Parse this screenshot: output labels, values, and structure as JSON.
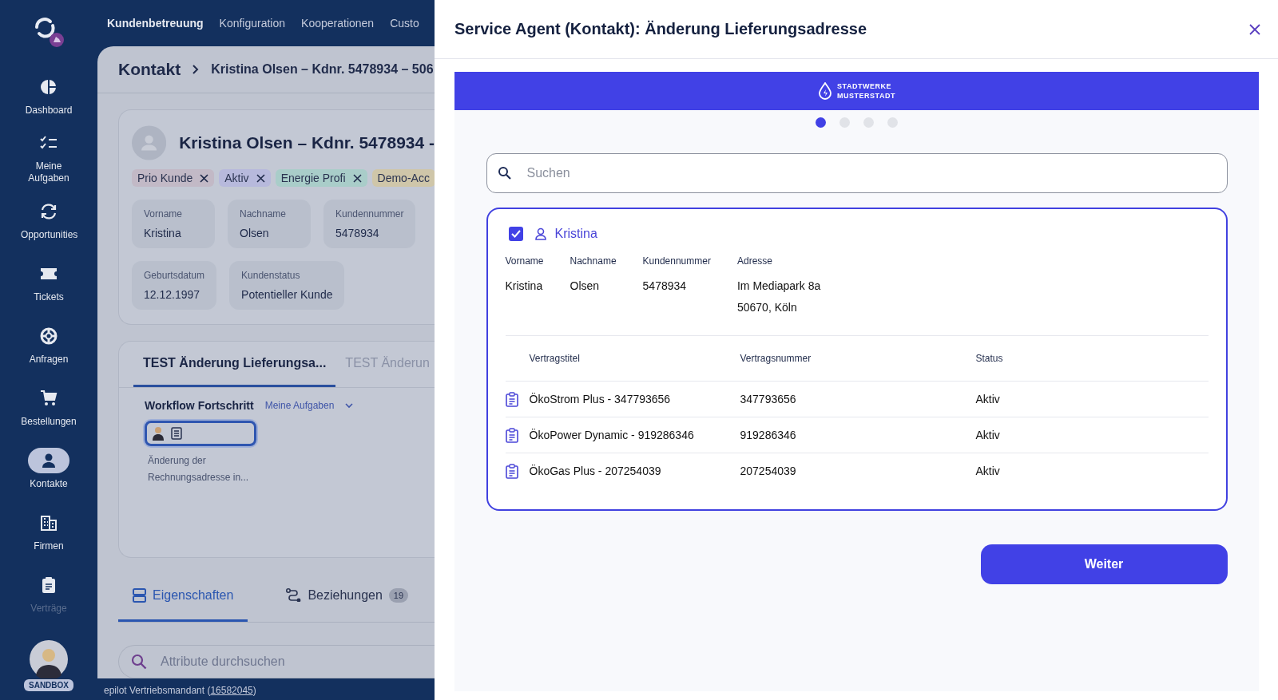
{
  "sidebar": {
    "items": [
      {
        "label": "Dashboard",
        "selected": false
      },
      {
        "label": "Meine Aufgaben",
        "selected": false
      },
      {
        "label": "Opportunities",
        "selected": false
      },
      {
        "label": "Tickets",
        "selected": false
      },
      {
        "label": "Anfragen",
        "selected": false
      },
      {
        "label": "Bestellungen",
        "selected": false
      },
      {
        "label": "Kontakte",
        "selected": true
      },
      {
        "label": "Firmen",
        "selected": false
      },
      {
        "label": "Verträge",
        "selected": false
      }
    ],
    "user_badge": "SANDBOX"
  },
  "top_nav": [
    {
      "label": "Kundenbetreuung",
      "selected": true
    },
    {
      "label": "Konfiguration",
      "selected": false
    },
    {
      "label": "Kooperationen",
      "selected": false
    },
    {
      "label": "Custo",
      "selected": false
    }
  ],
  "breadcrumb": {
    "root": "Kontakt",
    "current": "Kristina Olsen – Kdnr. 5478934 – 506"
  },
  "contact_card": {
    "title": "Kristina Olsen – Kdnr. 5478934 -",
    "tags": [
      {
        "label": "Prio Kunde",
        "color": "#c2b9c6",
        "removable": true
      },
      {
        "label": "Aktiv",
        "color": "#b7b9dc",
        "removable": true
      },
      {
        "label": "Energie Profi",
        "color": "#a9cdc9",
        "removable": true
      },
      {
        "label": "Demo-Acc",
        "color": "#cfc6a9",
        "removable": false
      }
    ],
    "fields": [
      {
        "label": "Vorname",
        "value": "Kristina"
      },
      {
        "label": "Nachname",
        "value": "Olsen"
      },
      {
        "label": "Kundennummer",
        "value": "5478934"
      },
      {
        "label": "Geburtsdatum",
        "value": "12.12.1997"
      },
      {
        "label": "Kundenstatus",
        "value": "Potentieller Kunde"
      }
    ]
  },
  "workflow_card": {
    "tabs": [
      {
        "label": "TEST Änderung Lieferungsa...",
        "selected": true
      },
      {
        "label": "TEST Änderun",
        "selected": false
      }
    ],
    "heading": "Workflow Fortschritt",
    "filter": "Meine Aufgaben",
    "step_lines": [
      "Änderung der",
      "Rechnungsadresse in..."
    ]
  },
  "detail_tabs": [
    {
      "label": "Eigenschaften",
      "selected": true
    },
    {
      "label": "Beziehungen",
      "count": "19",
      "selected": false
    }
  ],
  "attribute_search": {
    "placeholder": "Attribute durchsuchen"
  },
  "footer": {
    "prefix": "epilot Vertriebsmandant (",
    "link": "16582045",
    "suffix": ")"
  },
  "modal": {
    "title": "Service Agent (Kontakt): Änderung Lieferungsadresse",
    "brand": [
      "STADTWERKE",
      "MUSTERSTADT"
    ],
    "steps": [
      {
        "selected": true
      },
      {
        "selected": false
      },
      {
        "selected": false
      },
      {
        "selected": false
      }
    ],
    "search": {
      "placeholder": "Suchen"
    },
    "contact": {
      "checked": true,
      "name": "Kristina",
      "fields": [
        {
          "label": "Vorname",
          "lines": [
            "Kristina"
          ]
        },
        {
          "label": "Nachname",
          "lines": [
            "Olsen"
          ]
        },
        {
          "label": "Kundennummer",
          "lines": [
            "5478934"
          ]
        },
        {
          "label": "Adresse",
          "lines": [
            "Im Mediapark 8a",
            "50670, Köln"
          ]
        }
      ]
    },
    "contracts": {
      "columns": [
        "Vertragstitel",
        "Vertragsnummer",
        "Status"
      ],
      "rows": [
        [
          "ÖkoStrom Plus - 347793656",
          "347793656",
          "Aktiv"
        ],
        [
          "ÖkoPower Dynamic - 919286346",
          "919286346",
          "Aktiv"
        ],
        [
          "ÖkoGas Plus - 207254039",
          "207254039",
          "Aktiv"
        ]
      ]
    },
    "next_button": "Weiter"
  }
}
